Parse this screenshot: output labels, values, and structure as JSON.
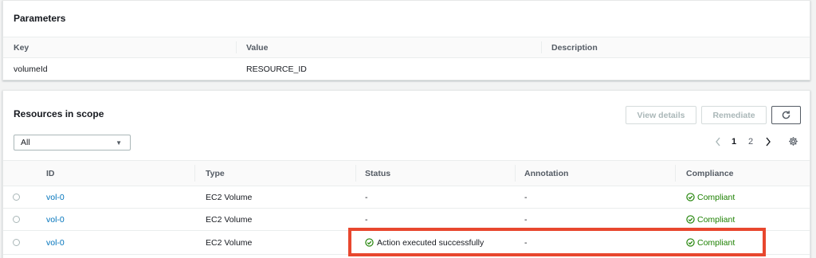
{
  "parameters": {
    "title": "Parameters",
    "columns": [
      "Key",
      "Value",
      "Description"
    ],
    "rows": [
      {
        "key": "volumeId",
        "value": "RESOURCE_ID",
        "description": ""
      }
    ]
  },
  "resources": {
    "title": "Resources in scope",
    "buttons": {
      "view_details": "View details",
      "remediate": "Remediate",
      "refresh_icon": "refresh-icon"
    },
    "filter": {
      "selected": "All"
    },
    "pagination": {
      "prev_icon": "chevron-left-icon",
      "pages": [
        "1",
        "2"
      ],
      "current_page": "1",
      "next_icon": "chevron-right-icon",
      "settings_icon": "gear-icon"
    },
    "columns": [
      "ID",
      "Type",
      "Status",
      "Annotation",
      "Compliance"
    ],
    "rows": [
      {
        "id": "vol-0",
        "type": "EC2 Volume",
        "status": "-",
        "annotation": "-",
        "compliance": "Compliant"
      },
      {
        "id": "vol-0",
        "type": "EC2 Volume",
        "status": "-",
        "annotation": "-",
        "compliance": "Compliant"
      },
      {
        "id": "vol-0",
        "type": "EC2 Volume",
        "status": "Action executed successfully",
        "annotation": "-",
        "compliance": "Compliant"
      }
    ]
  },
  "colors": {
    "link": "#0073bb",
    "success": "#1d8102",
    "highlight": "#e8472e"
  }
}
